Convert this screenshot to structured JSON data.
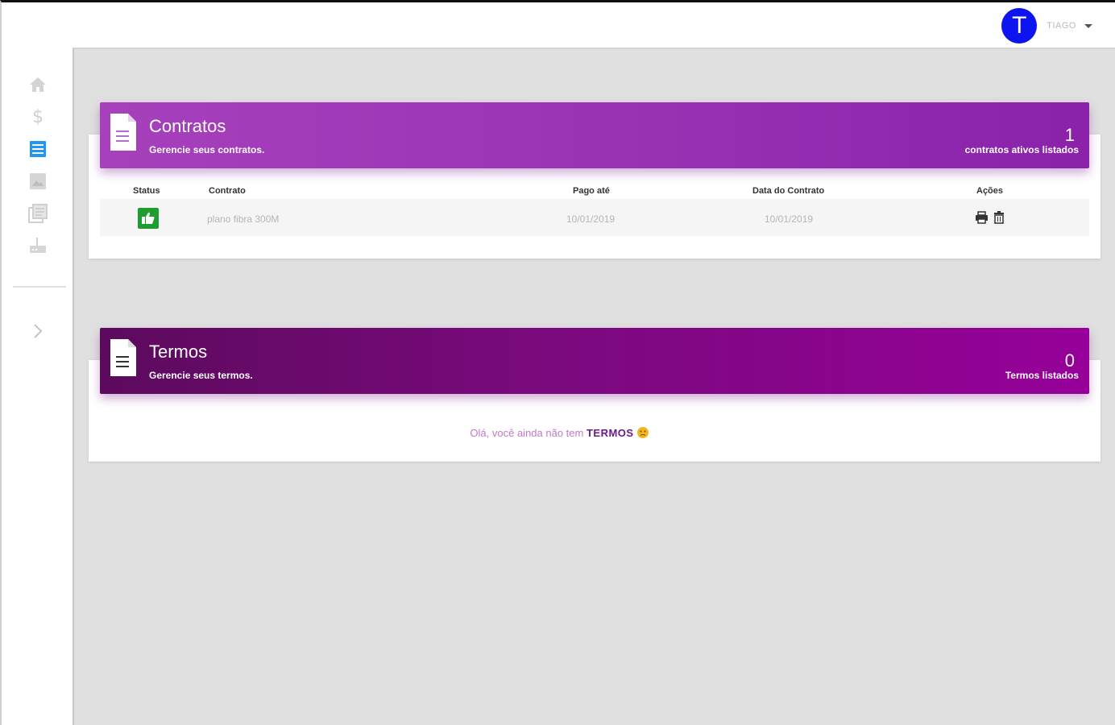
{
  "header": {
    "user_initial": "T",
    "user_name": "TIAGO"
  },
  "sidebar": {
    "items": [
      {
        "icon": "home-icon"
      },
      {
        "icon": "dollar-icon"
      },
      {
        "icon": "list-icon",
        "active": true
      },
      {
        "icon": "image-icon"
      },
      {
        "icon": "library-icon"
      },
      {
        "icon": "router-icon"
      },
      {
        "icon": "chevron-right-icon"
      }
    ]
  },
  "contratos": {
    "title": "Contratos",
    "subtitle": "Gerencie seus contratos.",
    "count": "1",
    "count_label": "contratos ativos listados",
    "columns": [
      "Status",
      "Contrato",
      "Pago até",
      "Data do Contrato",
      "Ações"
    ],
    "rows": [
      {
        "status_icon": "thumbs-up-icon",
        "contrato": "plano fibra 300M",
        "pago_ate": "10/01/2019",
        "data_contrato": "10/01/2019"
      }
    ]
  },
  "termos": {
    "title": "Termos",
    "subtitle": "Gerencie seus termos.",
    "count": "0",
    "count_label": "Termos listados",
    "empty_prefix": "Olá, você ainda não tem ",
    "empty_keyword": "TERMOS"
  },
  "colors": {
    "contratos_gradient": [
      "#a340b8",
      "#8a1fa8"
    ],
    "termos_gradient": [
      "#5e0a5e",
      "#950098"
    ],
    "avatar": "#0d14f0",
    "active_nav": "#2196f3",
    "status_ok": "#1e9e2e"
  }
}
